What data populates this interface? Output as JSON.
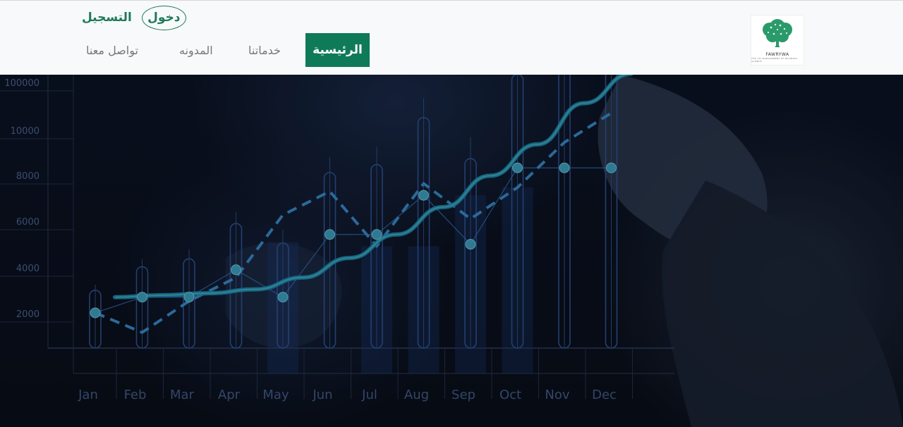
{
  "header": {
    "logo": {
      "name": "FAWRYWA",
      "tagline": "THE 1ST MANAGEMENT OF BUSINESS SCIENCE"
    },
    "auth": {
      "login_label": "دخول",
      "register_label": "التسجيل"
    },
    "nav": {
      "home": "الرئيسية",
      "services": "خدماتنا",
      "blog": "المدونه",
      "contact": "تواصل معنا"
    },
    "accent_color": "#0f7a58"
  },
  "hero": {
    "chart_data": {
      "type": "line",
      "categories": [
        "Jan",
        "Feb",
        "Mar",
        "Apr",
        "May",
        "Jun",
        "Jul",
        "Aug",
        "Sep",
        "Oct",
        "Nov",
        "Dec"
      ],
      "y_ticks": [
        "2000",
        "4000",
        "6000",
        "8000",
        "10000",
        "100000"
      ],
      "series": [
        {
          "style": "points",
          "values": [
            1800,
            2600,
            2600,
            4000,
            2600,
            5800,
            5800,
            7800,
            5300,
            9200,
            9200,
            9200
          ]
        },
        {
          "style": "dashed",
          "values": [
            1800,
            800,
            2400,
            3600,
            6800,
            8000,
            5200,
            8400,
            6600,
            8200,
            10500,
            12000
          ]
        },
        {
          "style": "curve",
          "values": [
            2600,
            2700,
            2800,
            3000,
            3600,
            4600,
            5800,
            7200,
            8800,
            10400,
            12500,
            15000
          ]
        }
      ],
      "grid": true,
      "background": "dark-photo-overlay"
    }
  }
}
